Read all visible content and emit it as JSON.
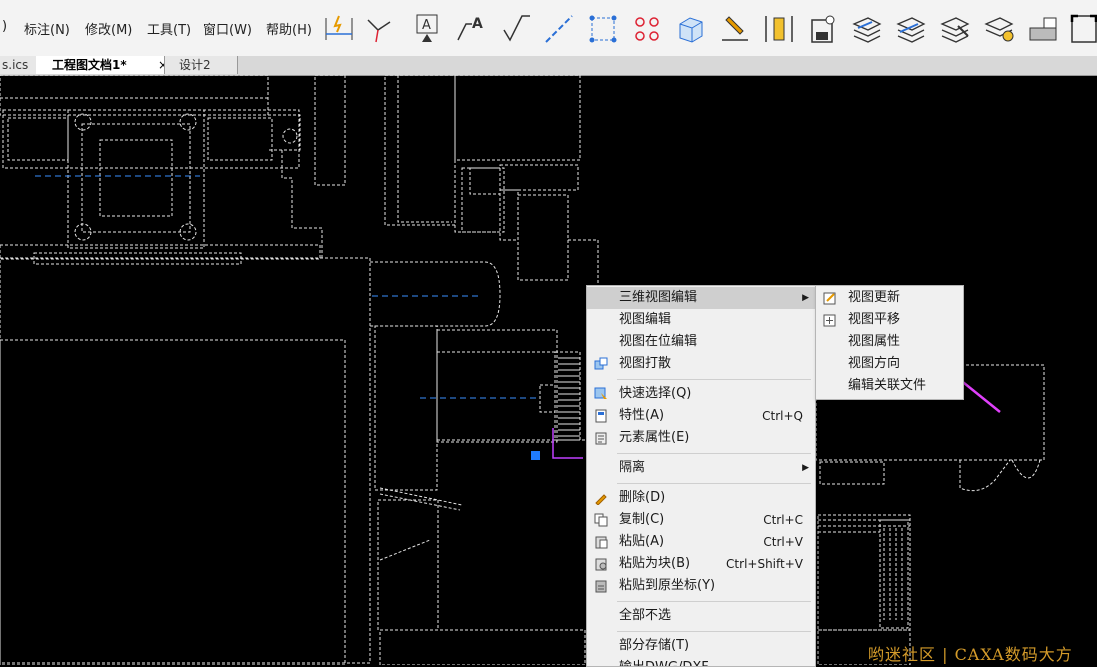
{
  "menubar": {
    "items": [
      {
        "label": ")",
        "name": "menu-partial"
      },
      {
        "label": "标注(N)",
        "name": "menu-annotate"
      },
      {
        "label": "修改(M)",
        "name": "menu-modify"
      },
      {
        "label": "工具(T)",
        "name": "menu-tools"
      },
      {
        "label": "窗口(W)",
        "name": "menu-window"
      },
      {
        "label": "帮助(H)",
        "name": "menu-help"
      }
    ]
  },
  "toolbar": {
    "icons": [
      "dimension-icon",
      "break-line-icon",
      "text-label-icon",
      "leader-text-icon",
      "roughness-icon",
      "centerline-icon",
      "select-box-icon",
      "array-points-icon",
      "3d-box-icon",
      "pencil-line-icon",
      "ruler-icon",
      "save-disk-icon",
      "layers-icon",
      "layers-edit-icon",
      "layers-pencil-icon",
      "layers-light-icon",
      "toggle-icon",
      "fullscreen-icon"
    ]
  },
  "tabs": [
    {
      "label": "s.ics",
      "name": "tab-ics"
    },
    {
      "label": "工程图文档1*",
      "name": "tab-drawing-1",
      "close": "×"
    },
    {
      "label": "设计2",
      "name": "tab-design-2"
    }
  ],
  "context_menu": {
    "groups": [
      [
        {
          "label": "三维视图编辑",
          "submenu": true,
          "highlighted": true,
          "icon": ""
        },
        {
          "label": "视图编辑",
          "icon": ""
        },
        {
          "label": "视图在位编辑",
          "icon": ""
        },
        {
          "label": "视图打散",
          "icon": "explode-icon"
        }
      ],
      [
        {
          "label": "快速选择(Q)",
          "icon": "quick-select-icon"
        },
        {
          "label": "特性(A)",
          "shortcut": "Ctrl+Q",
          "icon": "properties-icon"
        },
        {
          "label": "元素属性(E)",
          "icon": "element-props-icon"
        }
      ],
      [
        {
          "label": "隔离",
          "submenu": true,
          "icon": ""
        }
      ],
      [
        {
          "label": "删除(D)",
          "icon": "delete-icon"
        },
        {
          "label": "复制(C)",
          "shortcut": "Ctrl+C",
          "icon": "copy-icon"
        },
        {
          "label": "粘贴(A)",
          "shortcut": "Ctrl+V",
          "icon": "paste-icon"
        },
        {
          "label": "粘贴为块(B)",
          "shortcut": "Ctrl+Shift+V",
          "icon": "paste-block-icon"
        },
        {
          "label": "粘贴到原坐标(Y)",
          "icon": "paste-origin-icon"
        }
      ],
      [
        {
          "label": "全部不选",
          "icon": ""
        }
      ],
      [
        {
          "label": "部分存储(T)",
          "icon": ""
        },
        {
          "label": "输出DWG/DXF",
          "icon": ""
        }
      ]
    ]
  },
  "submenu": {
    "items": [
      {
        "label": "视图更新",
        "icon": "view-update-icon"
      },
      {
        "label": "视图平移",
        "icon": "view-pan-icon"
      },
      {
        "label": "视图属性",
        "icon": ""
      },
      {
        "label": "视图方向",
        "icon": ""
      },
      {
        "label": "编辑关联文件",
        "icon": ""
      }
    ]
  },
  "annotation": {
    "arrow_color": "#e040fb"
  },
  "watermark": "哟迷社区 | CAXA数码大方"
}
